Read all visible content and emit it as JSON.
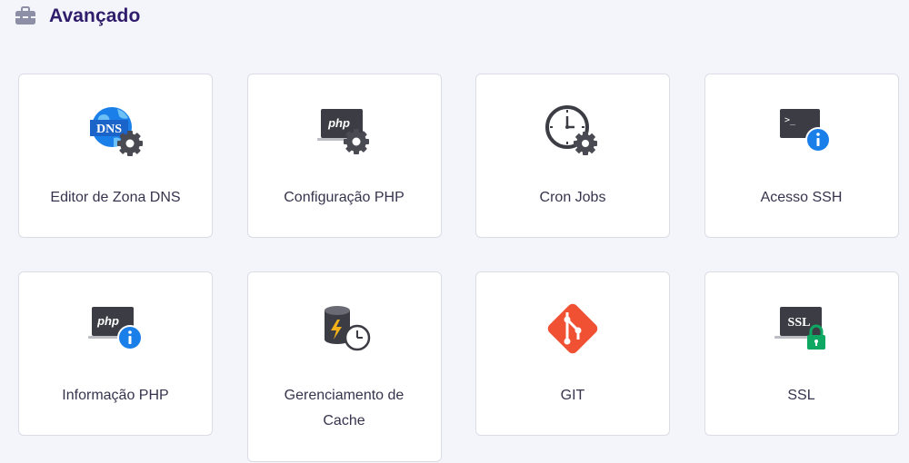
{
  "section": {
    "title": "Avançado",
    "icon": "toolbox-icon"
  },
  "cards": [
    {
      "label": "Editor de Zona DNS",
      "icon": "dns-globe-gear-icon"
    },
    {
      "label": "Configuração PHP",
      "icon": "php-monitor-gear-icon"
    },
    {
      "label": "Cron Jobs",
      "icon": "clock-gear-icon"
    },
    {
      "label": "Acesso SSH",
      "icon": "terminal-info-icon"
    },
    {
      "label": "Informação PHP",
      "icon": "php-monitor-info-icon"
    },
    {
      "label": "Gerenciamento de Cache",
      "icon": "database-clock-icon"
    },
    {
      "label": "GIT",
      "icon": "git-icon"
    },
    {
      "label": "SSL",
      "icon": "ssl-monitor-lock-icon"
    }
  ],
  "colors": {
    "title": "#2f1c6a",
    "label": "#36344d",
    "background": "#f4f4fb",
    "info_blue": "#1a7fe8",
    "git_red": "#f05133",
    "lock_green": "#0fa862"
  }
}
